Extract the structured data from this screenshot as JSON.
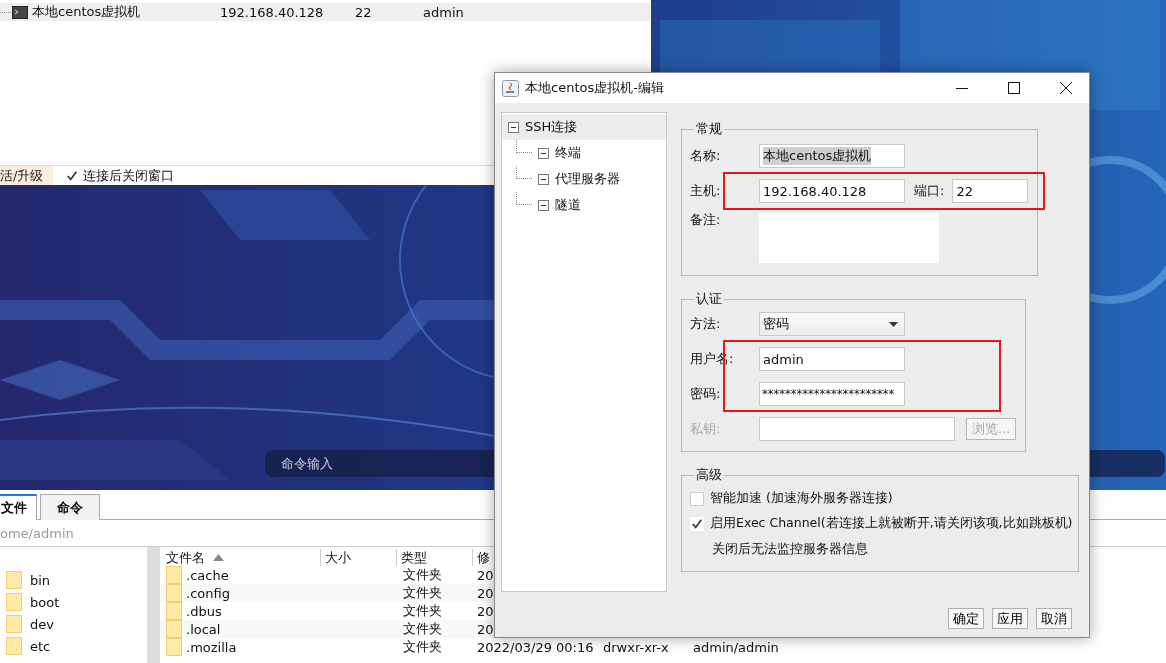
{
  "connection_list": {
    "rows": [
      {
        "name": "本地centos虚拟机",
        "host": "192.168.40.128",
        "port": "22",
        "user": "admin",
        "selected": true
      }
    ]
  },
  "status_bar": {
    "activate_link": "活/升级",
    "close_after_connect": {
      "label": "连接后关闭窗口",
      "checked": true
    }
  },
  "command_input": {
    "placeholder": "命令输入"
  },
  "file_browser": {
    "tabs": [
      {
        "label": "文件",
        "selected": true
      },
      {
        "label": "命令",
        "selected": false
      }
    ],
    "path": "ome/admin",
    "folders": [
      "bin",
      "boot",
      "dev",
      "etc"
    ],
    "columns": [
      {
        "label": "文件名",
        "sorted": true
      },
      {
        "label": "大小"
      },
      {
        "label": "类型"
      },
      {
        "label": "修"
      }
    ],
    "rows": [
      {
        "name": ".cache",
        "type": "文件夹",
        "modified": "20"
      },
      {
        "name": ".config",
        "type": "文件夹",
        "modified": "20"
      },
      {
        "name": ".dbus",
        "type": "文件夹",
        "modified": "20"
      },
      {
        "name": ".local",
        "type": "文件夹",
        "modified": "20"
      },
      {
        "name": ".mozilla",
        "type": "文件夹",
        "modified": "2022/03/29 00:16",
        "permissions": "drwxr-xr-x",
        "owner": "admin/admin"
      }
    ]
  },
  "dialog": {
    "title": "本地centos虚拟机-编辑",
    "tree": [
      {
        "label": "SSH连接",
        "selected": true,
        "expanded": true,
        "children": [
          {
            "label": "终端",
            "selected": false,
            "expanded": true
          },
          {
            "label": "代理服务器",
            "selected": false,
            "expanded": true
          },
          {
            "label": "隧道",
            "selected": false,
            "expanded": true
          }
        ]
      }
    ],
    "general": {
      "title": "常规",
      "highlighted": true,
      "name": {
        "label": "名称:",
        "value": "本地centos虚拟机",
        "text_selected": true
      },
      "host": {
        "label": "主机:",
        "value": "192.168.40.128"
      },
      "port": {
        "label": "端口:",
        "value": "22"
      },
      "note": {
        "label": "备注:"
      }
    },
    "auth": {
      "title": "认证",
      "highlighted": true,
      "method": {
        "label": "方法:",
        "value": "密码"
      },
      "username": {
        "label": "用户名:",
        "value": "admin"
      },
      "password": {
        "label": "密码:",
        "value": "***********************"
      },
      "private_key": {
        "label": "私钥:",
        "disabled": true
      },
      "browse_button": {
        "label": "浏览...",
        "disabled": true
      }
    },
    "advanced": {
      "title": "高级",
      "options": [
        {
          "label": "智能加速 (加速海外服务器连接)",
          "checked": false
        },
        {
          "label": "启用Exec Channel(若连接上就被断开,请关闭该项,比如跳板机)",
          "checked": true
        }
      ],
      "note": "关闭后无法监控服务器信息"
    },
    "buttons": [
      "确定",
      "应用",
      "取消"
    ]
  }
}
